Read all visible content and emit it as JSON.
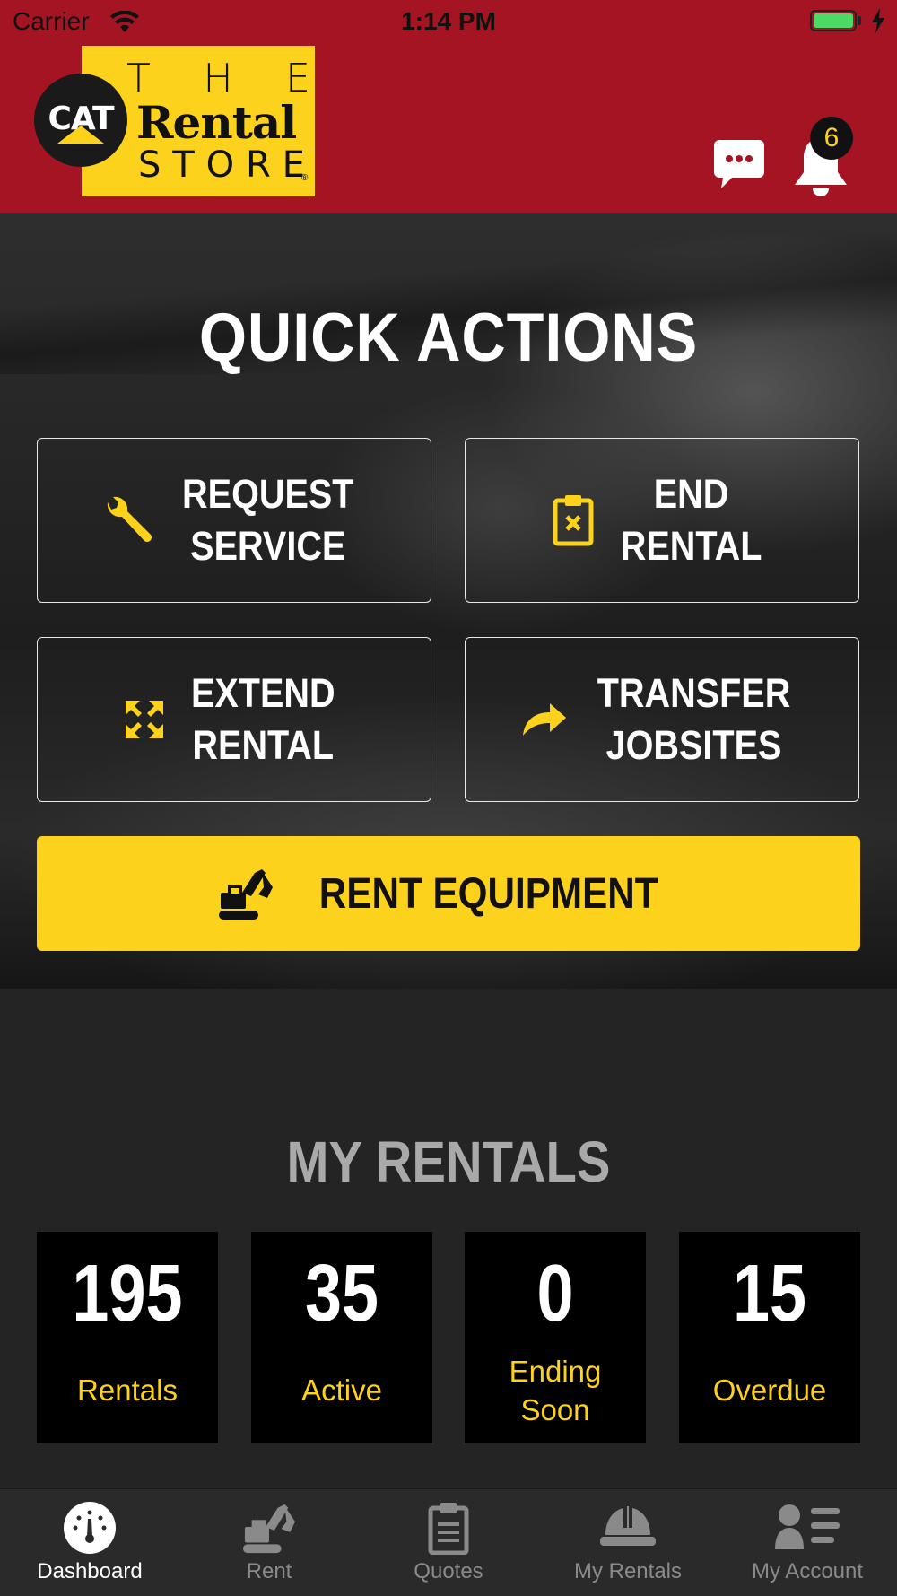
{
  "status_bar": {
    "carrier": "Carrier",
    "time": "1:14 PM"
  },
  "logo": {
    "the": [
      "T",
      "H",
      "E"
    ],
    "rental": "Rental",
    "store": [
      "S",
      "T",
      "O",
      "R",
      "E"
    ],
    "cat": "CAT",
    "reg": "®"
  },
  "header": {
    "notification_count": "6",
    "chat_icon": "chat-bubble-icon",
    "bell_icon": "bell-icon"
  },
  "quick_actions": {
    "title": "QUICK ACTIONS",
    "items": [
      {
        "line1": "REQUEST",
        "line2": "SERVICE",
        "icon": "wrench-icon"
      },
      {
        "line1": "END",
        "line2": "RENTAL",
        "icon": "clipboard-x-icon"
      },
      {
        "line1": "EXTEND",
        "line2": "RENTAL",
        "icon": "expand-arrows-icon"
      },
      {
        "line1": "TRANSFER",
        "line2": "JOBSITES",
        "icon": "share-arrow-icon"
      }
    ],
    "rent_button": {
      "label": "RENT EQUIPMENT",
      "icon": "excavator-icon"
    }
  },
  "my_rentals": {
    "title": "MY RENTALS",
    "stats": [
      {
        "value": "195",
        "label_line1": "Rentals",
        "label_line2": ""
      },
      {
        "value": "35",
        "label_line1": "Active",
        "label_line2": ""
      },
      {
        "value": "0",
        "label_line1": "Ending",
        "label_line2": "Soon"
      },
      {
        "value": "15",
        "label_line1": "Overdue",
        "label_line2": ""
      }
    ]
  },
  "tabs": [
    {
      "label": "Dashboard",
      "icon": "gauge-icon",
      "active": true
    },
    {
      "label": "Rent",
      "icon": "excavator-icon",
      "active": false
    },
    {
      "label": "Quotes",
      "icon": "clipboard-icon",
      "active": false
    },
    {
      "label": "My Rentals",
      "icon": "hardhat-icon",
      "active": false
    },
    {
      "label": "My Account",
      "icon": "account-icon",
      "active": false
    }
  ],
  "colors": {
    "brand_red": "#a51422",
    "brand_yellow": "#fdd21c",
    "background": "#242424"
  }
}
